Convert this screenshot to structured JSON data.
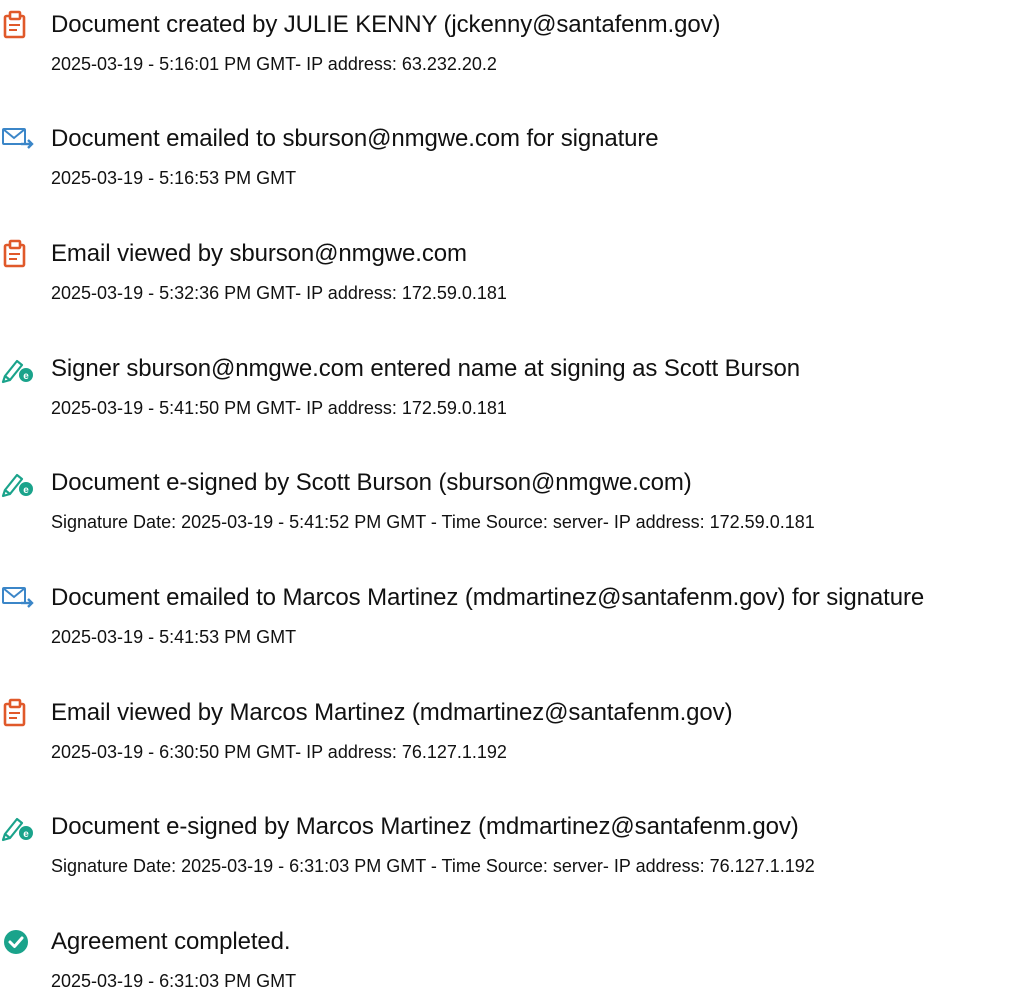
{
  "colors": {
    "doc_icon": "#e0592a",
    "email_icon": "#3b86c8",
    "sign_icon": "#1aa38b",
    "complete_icon": "#1aa38b"
  },
  "events": [
    {
      "icon": "document-icon",
      "title": "Document created by JULIE KENNY (jckenny@santafenm.gov)",
      "detail": "2025-03-19 - 5:16:01 PM GMT- IP address: 63.232.20.2"
    },
    {
      "icon": "email-sent-icon",
      "title": "Document emailed to sburson@nmgwe.com for signature",
      "detail": "2025-03-19 - 5:16:53 PM GMT"
    },
    {
      "icon": "document-icon",
      "title": "Email viewed by sburson@nmgwe.com",
      "detail": "2025-03-19 - 5:32:36 PM GMT- IP address: 172.59.0.181"
    },
    {
      "icon": "e-sign-pen-icon",
      "title": "Signer sburson@nmgwe.com entered name at signing as Scott Burson",
      "detail": "2025-03-19 - 5:41:50 PM GMT- IP address: 172.59.0.181"
    },
    {
      "icon": "e-sign-pen-icon",
      "title": "Document e-signed by Scott Burson (sburson@nmgwe.com)",
      "detail": "Signature Date: 2025-03-19 - 5:41:52 PM GMT - Time Source: server- IP address: 172.59.0.181"
    },
    {
      "icon": "email-sent-icon",
      "title": "Document emailed to Marcos Martinez (mdmartinez@santafenm.gov) for signature",
      "detail": "2025-03-19 - 5:41:53 PM GMT"
    },
    {
      "icon": "document-icon",
      "title": "Email viewed by Marcos Martinez (mdmartinez@santafenm.gov)",
      "detail": "2025-03-19 - 6:30:50 PM GMT- IP address: 76.127.1.192"
    },
    {
      "icon": "e-sign-pen-icon",
      "title": "Document e-signed by Marcos Martinez (mdmartinez@santafenm.gov)",
      "detail": "Signature Date: 2025-03-19 - 6:31:03 PM GMT - Time Source: server- IP address: 76.127.1.192"
    },
    {
      "icon": "check-circle-icon",
      "title": "Agreement completed.",
      "detail": "2025-03-19 - 6:31:03 PM GMT"
    }
  ]
}
